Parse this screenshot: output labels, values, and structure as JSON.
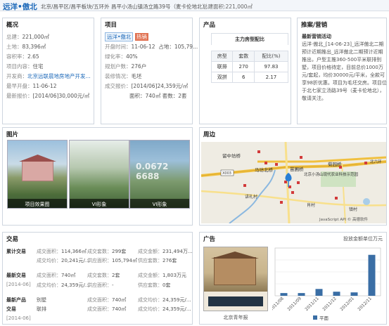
{
  "header": {
    "title": "远洋•傲北",
    "address": "北京/昌平区/昌平板块/五环外  昌平小汤山镇汤立路39号（麦卡伦地北）",
    "total_area": "总建面积:221,000㎡"
  },
  "overview": {
    "title": "概况",
    "rows": [
      {
        "label": "总建：",
        "value": "221,000㎡"
      },
      {
        "label": "土地：",
        "value": "83,396㎡"
      },
      {
        "label": "容积率：",
        "value": "2.65"
      },
      {
        "label": "项目内容：",
        "value": "住宅"
      },
      {
        "label": "开发商：",
        "value": "北京远联晨地房地产开发..."
      },
      {
        "label": "最早开盘：",
        "value": "11-06-12"
      },
      {
        "label": "最新报价：",
        "value": "[2014/06]30,000元/㎡"
      }
    ]
  },
  "project": {
    "title": "项目",
    "name": "远洋•傲北",
    "status": "热销",
    "rows": [
      {
        "label": "开盘时间：",
        "value": "11-06-12",
        "extra": "占地：105,79..."
      },
      {
        "label": "绿化率：",
        "value": "40%"
      },
      {
        "label": "规划户数：",
        "value": "276户"
      },
      {
        "label": "装修情况：",
        "value": "毛坯"
      },
      {
        "label": "成交报价：",
        "value": "[2014/06]24,359元/㎡"
      },
      {
        "label": "",
        "value": "面积：740㎡  套数：2套"
      }
    ]
  },
  "product": {
    "title": "产品",
    "table_title": "主力房型配比",
    "headers": [
      "房型",
      "套数",
      "配比(%)"
    ],
    "rows": [
      {
        "type": "联排",
        "count": "270",
        "pct": "97.83"
      },
      {
        "type": "双拼",
        "count": "6",
        "pct": "2.17"
      }
    ]
  },
  "promo": {
    "title": "推案/营销",
    "news_title": "最新营销活动",
    "news_body": "远洋·傲北_[14-06-23]_远洋傲北二期预计近期推出_远洋傲北二期预计近期推出，户型主推360-500平米联排别墅，项目价格待定，目前总价1000万元/套起，均价30000元/平米，全款可享98折优惠。项目为毛坯交房。项目位于北七家立汤路39号（麦卡伦地北），敬请关注。"
  },
  "images": {
    "title": "图片",
    "items": [
      {
        "label": "项目效果图"
      },
      {
        "label": "VI形象"
      },
      {
        "label": "VI形象"
      }
    ]
  },
  "map": {
    "title": "周边",
    "labels": [
      "留中坊桥",
      "马坊北桥",
      "苗圃桥",
      "菊园桥",
      "北六环",
      "X003",
      "北京小汤山现代农业科技示范园",
      "讲礼村",
      "肖村",
      "镇村"
    ],
    "credit": "JavaScript API © 高德软件"
  },
  "trade": {
    "title": "交易",
    "sections": [
      {
        "heading": "累计交易",
        "date": "",
        "lines": [
          [
            "成交面积：",
            "114,366㎡",
            "成交套数：",
            "299套",
            "成交金额：",
            "231,494万..."
          ],
          [
            "成交均价：",
            "20,241元/...",
            "供应面积：",
            "105,794㎡",
            "供应套数：",
            "276套"
          ]
        ]
      },
      {
        "heading": "最新交易",
        "date": "[2014-06]",
        "lines": [
          [
            "成交面积：",
            "740㎡",
            "成交套数：",
            "2套",
            "成交金额：",
            "1,803万元"
          ],
          [
            "成交均价：",
            "24,359元/...",
            "供应面积：",
            "-",
            "供应套数：",
            "0套"
          ]
        ]
      },
      {
        "heading": "最新产品",
        "date": "[2014-06]",
        "lines": [
          [
            "别墅",
            "",
            "成交面积：",
            "740㎡",
            "成交均价：",
            "24,359元/..."
          ],
          [
            "联排",
            "",
            "成交面积：",
            "740㎡",
            "成交均价：",
            "24,359元/..."
          ]
        ]
      }
    ]
  },
  "ad": {
    "title": "广告",
    "caption": "北京青年报",
    "link": "投放金额单位万元"
  },
  "chart_data": {
    "type": "bar",
    "categories": [
      "2011/08",
      "2011/09",
      "2011/11",
      "2011/12",
      "2012/01",
      "2012/11"
    ],
    "series": [
      {
        "name": "平面",
        "values": [
          4,
          4,
          10,
          6,
          5,
          60
        ]
      }
    ],
    "ylim": [
      0,
      70
    ],
    "color": "#3a6ea5",
    "legend": "bottom"
  }
}
